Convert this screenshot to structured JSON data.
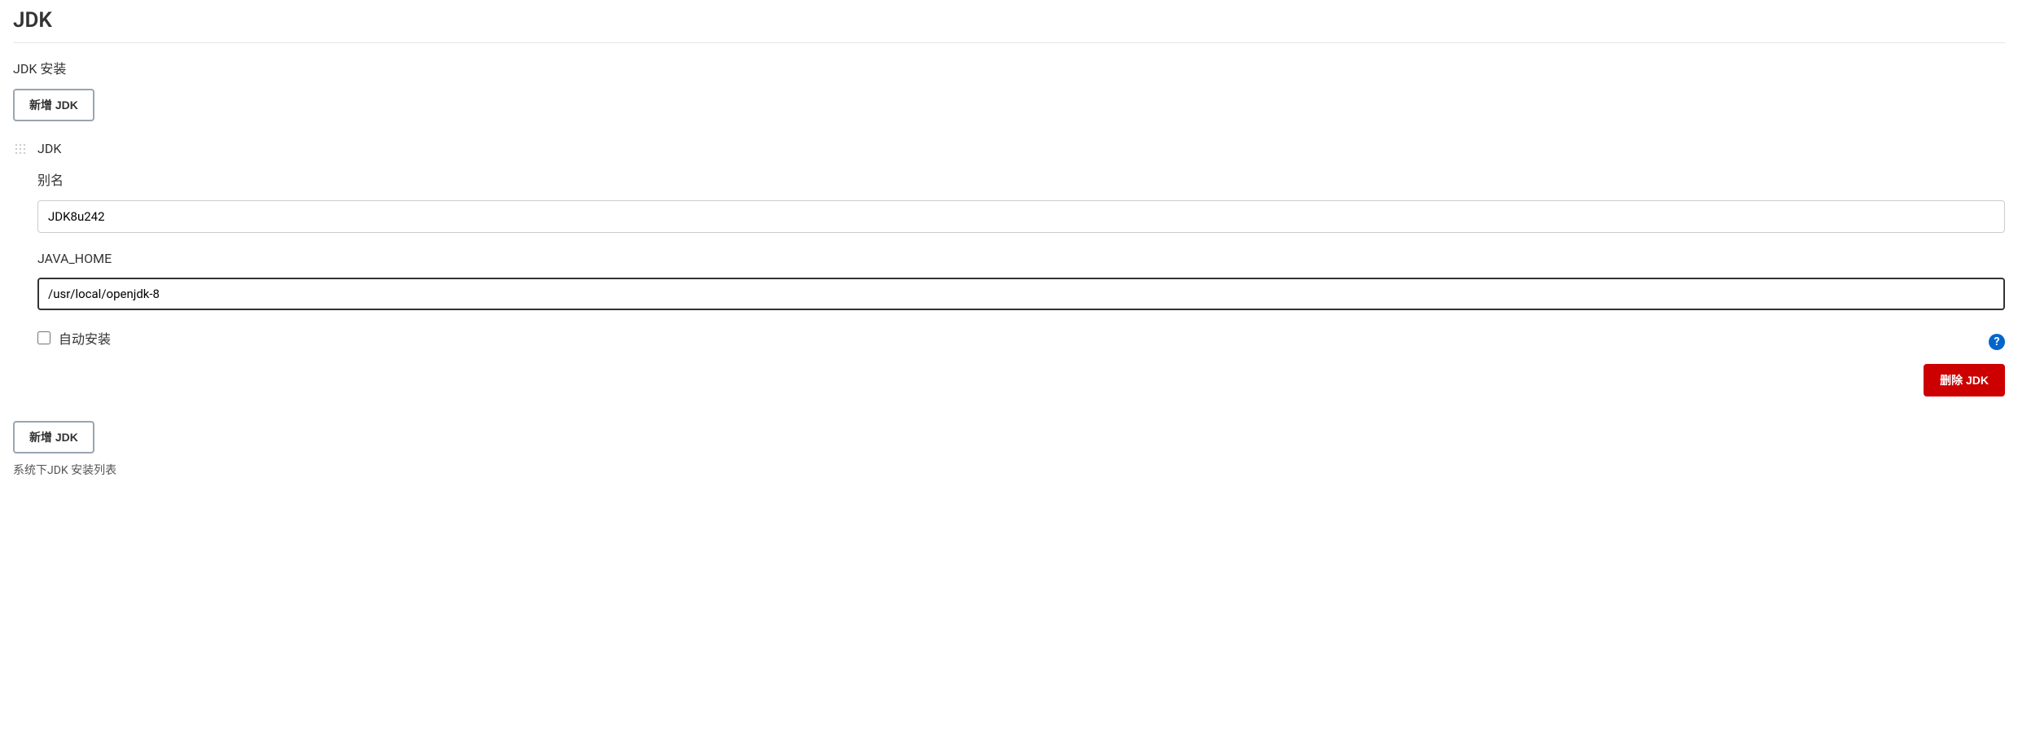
{
  "section": {
    "title": "JDK",
    "install_label": "JDK 安装"
  },
  "buttons": {
    "add_jdk": "新增 JDK",
    "delete_jdk": "删除 JDK"
  },
  "jdk_entry": {
    "header": "JDK",
    "alias_label": "别名",
    "alias_value": "JDK8u242",
    "java_home_label": "JAVA_HOME",
    "java_home_value": "/usr/local/openjdk-8",
    "auto_install_label": "自动安装"
  },
  "footer": {
    "help_text": "系统下JDK 安装列表"
  },
  "icons": {
    "help": "?"
  }
}
